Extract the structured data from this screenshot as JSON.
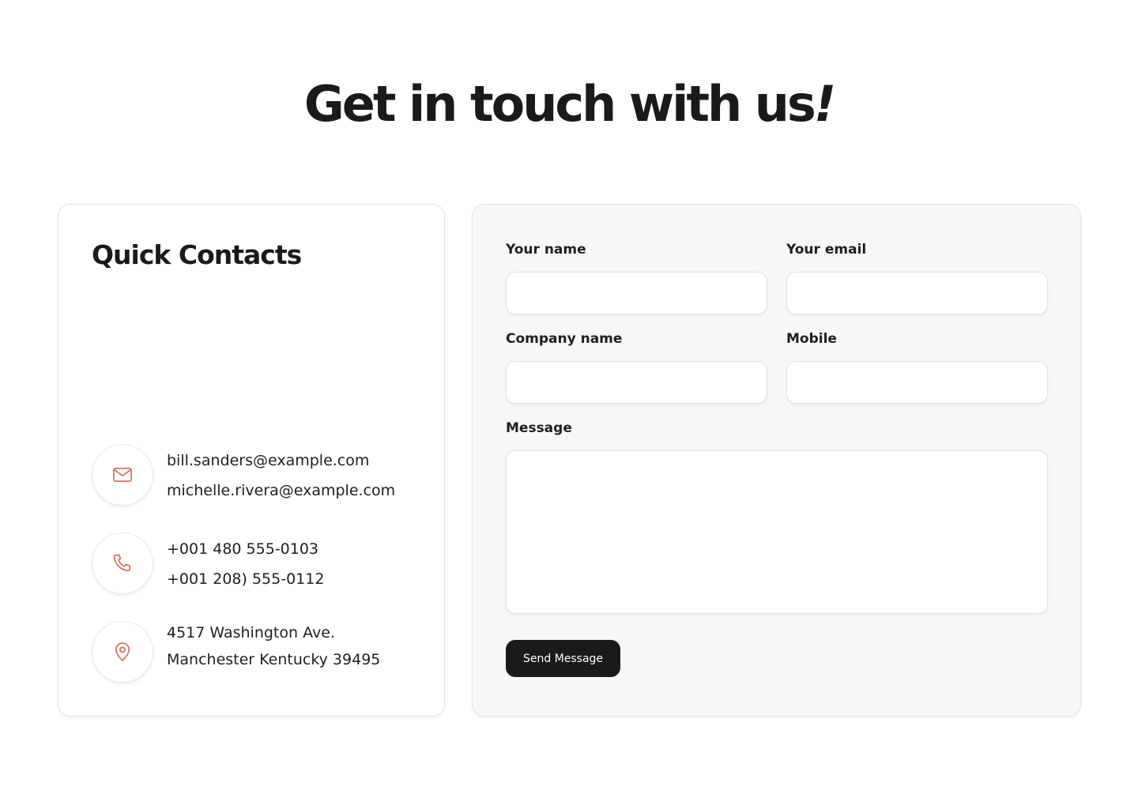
{
  "page": {
    "title": "Get in touch with us",
    "title_mark": "!"
  },
  "colors": {
    "accent": "#d9725a",
    "button_bg": "#1a1a1a",
    "form_card_bg": "#f8f7f5"
  },
  "quick_contacts": {
    "title": "Quick Contacts",
    "items": [
      {
        "icon": "mail-icon",
        "lines": [
          "bill.sanders@example.com",
          "michelle.rivera@example.com"
        ]
      },
      {
        "icon": "phone-icon",
        "lines": [
          "+001 480 555-0103",
          "+001 208) 555-0112"
        ]
      },
      {
        "icon": "map-pin-icon",
        "lines": [
          "4517 Washington Ave.",
          "Manchester Kentucky 39495"
        ]
      }
    ]
  },
  "form": {
    "name": {
      "label": "Your name",
      "value": ""
    },
    "email": {
      "label": "Your email",
      "value": ""
    },
    "company": {
      "label": "Company name",
      "value": ""
    },
    "mobile": {
      "label": "Mobile",
      "value": ""
    },
    "message": {
      "label": "Message",
      "value": ""
    },
    "submit_label": "Send Message"
  }
}
